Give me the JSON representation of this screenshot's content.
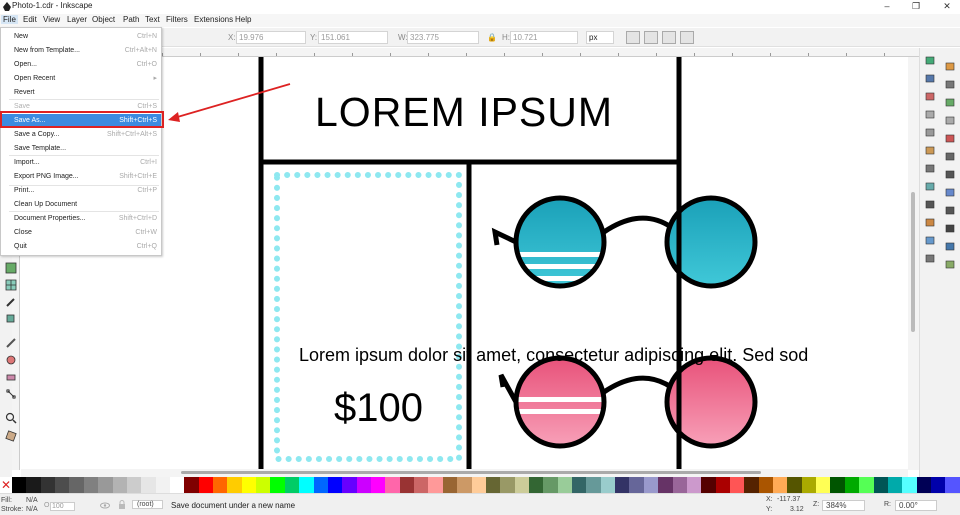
{
  "window": {
    "title": "Photo-1.cdr - Inkscape"
  },
  "menubar": [
    "File",
    "Edit",
    "View",
    "Layer",
    "Object",
    "Path",
    "Text",
    "Filters",
    "Extensions",
    "Help"
  ],
  "toolbar": {
    "x_label": "X:",
    "x": "19.976",
    "y_label": "Y:",
    "y": "151.061",
    "w_label": "W:",
    "w": "323.775",
    "h_label": "H:",
    "h": "10.721",
    "unit": "px"
  },
  "file_menu": [
    {
      "label": "New",
      "shortcut": "Ctrl+N",
      "disabled": false
    },
    {
      "label": "New from Template...",
      "shortcut": "Ctrl+Alt+N",
      "disabled": false
    },
    {
      "label": "Open...",
      "shortcut": "Ctrl+O",
      "disabled": false
    },
    {
      "label": "Open Recent",
      "shortcut": "▸",
      "disabled": false
    },
    {
      "label": "Revert",
      "shortcut": "",
      "disabled": false
    },
    {
      "label": "Save",
      "shortcut": "Ctrl+S",
      "disabled": true
    },
    {
      "label": "Save As...",
      "shortcut": "Shift+Ctrl+S",
      "disabled": false,
      "highlighted": true
    },
    {
      "label": "Save a Copy...",
      "shortcut": "Shift+Ctrl+Alt+S",
      "disabled": false
    },
    {
      "label": "Save Template...",
      "shortcut": "",
      "disabled": false
    },
    {
      "label": "Import...",
      "shortcut": "Ctrl+I",
      "disabled": false
    },
    {
      "label": "Export PNG Image...",
      "shortcut": "Shift+Ctrl+E",
      "disabled": false
    },
    {
      "label": "Print...",
      "shortcut": "Ctrl+P",
      "disabled": false
    },
    {
      "label": "Clean Up Document",
      "shortcut": "",
      "disabled": false
    },
    {
      "label": "Document Properties...",
      "shortcut": "Shift+Ctrl+D",
      "disabled": false
    },
    {
      "label": "Close",
      "shortcut": "Ctrl+W",
      "disabled": false
    },
    {
      "label": "Quit",
      "shortcut": "Ctrl+Q",
      "disabled": false
    }
  ],
  "document": {
    "heading": "LOREM IPSUM",
    "body": "Lorem ipsum dolor sit amet, consectetur adipiscing elit. Sed sod",
    "price": "$100"
  },
  "status": {
    "fill_label": "Fill:",
    "fill": "N/A",
    "stroke_label": "Stroke:",
    "stroke": "N/A",
    "opacity_label": "O:",
    "opacity": "100",
    "layer": "(root)",
    "message": "Save document under a new name",
    "x_label": "X:",
    "x": "-117.37",
    "y_label": "Y:",
    "y": "3.12",
    "zoom_label": "Z:",
    "zoom": "384%",
    "rotation_label": "R:",
    "rotation": "0.00°"
  },
  "colors": {
    "accent": "#3c8be0",
    "annotation": "#dd2222",
    "dots": "#8ee8f0",
    "lens_teal": "#1aa0b8",
    "lens_pink": "#e8527a"
  },
  "palette": [
    "#000000",
    "#1a1a1a",
    "#333333",
    "#4d4d4d",
    "#666666",
    "#808080",
    "#999999",
    "#b3b3b3",
    "#cccccc",
    "#e6e6e6",
    "#f2f2f2",
    "#ffffff",
    "#800000",
    "#ff0000",
    "#ff6600",
    "#ffcc00",
    "#ffff00",
    "#ccff00",
    "#00ff00",
    "#00cc66",
    "#00ffff",
    "#0066ff",
    "#0000ff",
    "#6600ff",
    "#cc00ff",
    "#ff00ff",
    "#ff66aa",
    "#993333",
    "#cc6666",
    "#ff9999",
    "#996633",
    "#cc9966",
    "#ffcc99",
    "#666633",
    "#999966",
    "#cccc99",
    "#336633",
    "#669966",
    "#99cc99",
    "#336666",
    "#669999",
    "#99cccc",
    "#333366",
    "#666699",
    "#9999cc",
    "#663366",
    "#996699",
    "#cc99cc",
    "#550000",
    "#aa0000",
    "#ff5555",
    "#552200",
    "#aa5500",
    "#ffaa55",
    "#555500",
    "#aaaa00",
    "#ffff55",
    "#005500",
    "#00aa00",
    "#55ff55",
    "#005555",
    "#00aaaa",
    "#55ffff",
    "#000055",
    "#0000aa",
    "#5555ff"
  ]
}
